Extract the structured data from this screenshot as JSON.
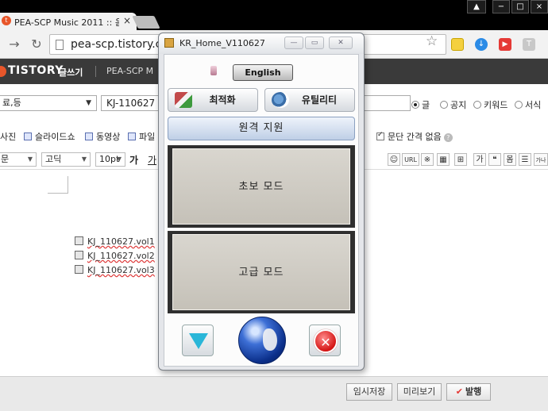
{
  "browser": {
    "tab_title": "PEA-SCP Music 2011 :: 음",
    "tab_favicon": "t",
    "tab_close": "×",
    "url": "pea-scp.tistory.c",
    "window_buttons": {
      "user": "▲",
      "min": "−",
      "max": "□",
      "close": "×"
    },
    "extensions": {
      "ext2": "↓",
      "ext3": "▶",
      "ext4": "T"
    }
  },
  "tistory_bar": {
    "logo": "TISTORY",
    "write": "글쓰기",
    "blog_name": "PEA-SCP M"
  },
  "editor": {
    "category": "료,등",
    "title": "KJ-110627",
    "radios": [
      "글",
      "공지",
      "키워드",
      "서식"
    ],
    "attachments": [
      "사진",
      "슬라이드쇼",
      "동영상",
      "파일"
    ],
    "paragraph_option": "문단 간격 없음",
    "help": "?",
    "font_selects": [
      "문",
      "고딕",
      "10pt"
    ],
    "bold_label": "가",
    "underline_label": "가",
    "toolbar_icons": [
      "☺",
      "URL",
      "※",
      "▦",
      "⊞",
      "가",
      "❝",
      "몸",
      "☰",
      "가나"
    ],
    "files": [
      "KJ_110627.vol1",
      "KJ_110627.vol2",
      "KJ_110627.vol3"
    ]
  },
  "bottom_bar": {
    "save_draft": "임시저장",
    "preview": "미리보기",
    "publish_check": "✔",
    "publish": "발행"
  },
  "popup": {
    "title": "KR_Home_V110627",
    "window_buttons": {
      "min": "—",
      "max": "▭",
      "close": "✕"
    },
    "language_button": "English",
    "optimize_button": "최적화",
    "utility_button": "유틸리티",
    "remote_support_button": "원격 지원",
    "basic_mode_button": "초보 모드",
    "advanced_mode_button": "고급 모드",
    "close_symbol": "✕"
  }
}
